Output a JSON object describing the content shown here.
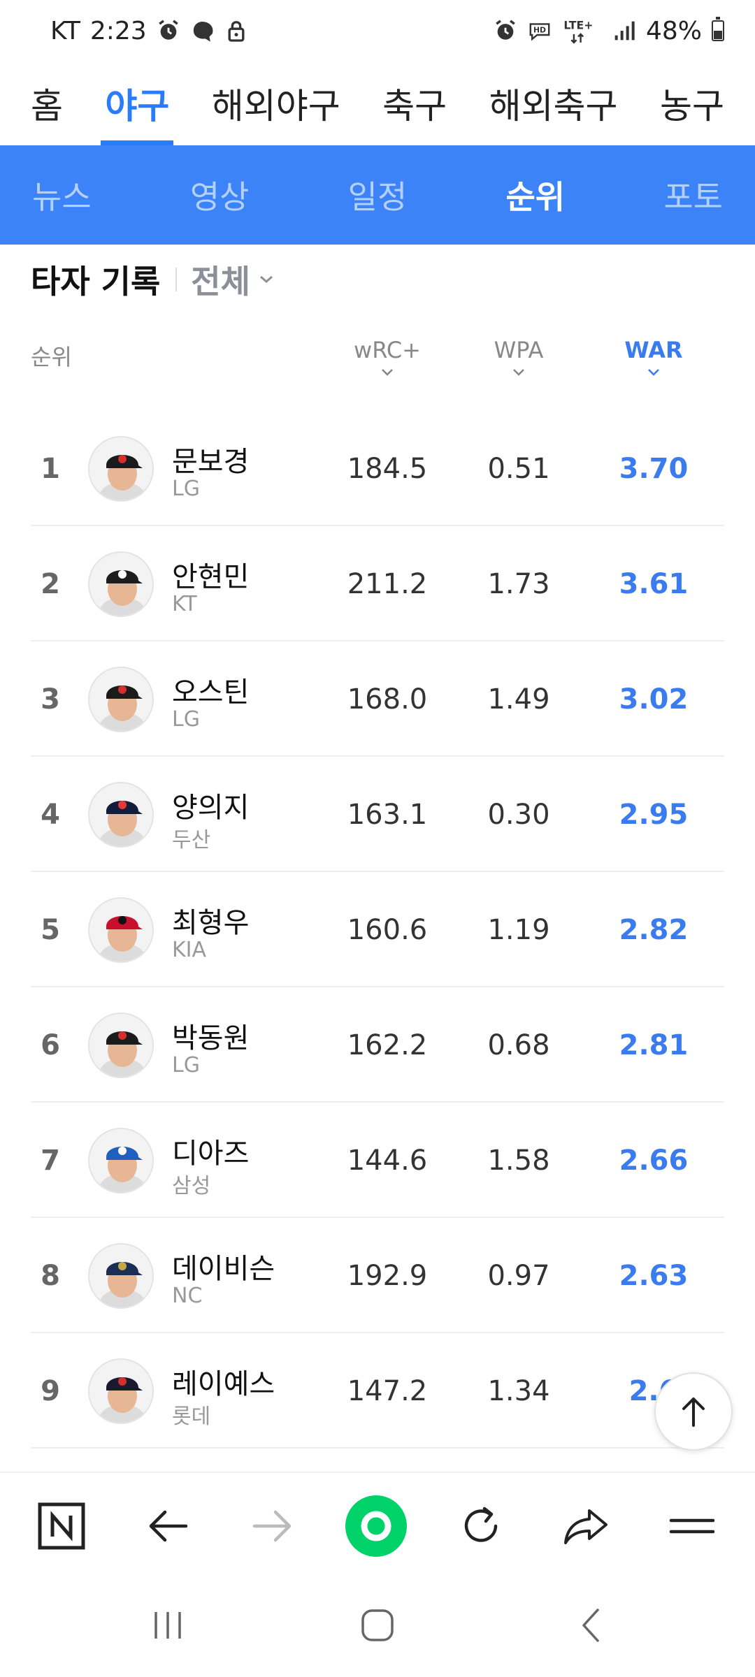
{
  "status_bar": {
    "carrier": "KT",
    "time": "2:23",
    "network": "LTE+",
    "battery": "48%",
    "battery_level": 0.48,
    "left_icons": [
      "alarm-icon",
      "messenger-icon",
      "lock-icon"
    ],
    "right_icons": [
      "alarm-icon",
      "hd-icon",
      "lte-icon",
      "signal-icon",
      "battery-icon"
    ]
  },
  "top_nav": {
    "tabs": [
      {
        "label": "홈"
      },
      {
        "label": "야구",
        "active": true
      },
      {
        "label": "해외야구"
      },
      {
        "label": "축구"
      },
      {
        "label": "해외축구"
      },
      {
        "label": "농구"
      }
    ]
  },
  "sub_nav": {
    "tabs": [
      {
        "label": "뉴스"
      },
      {
        "label": "영상"
      },
      {
        "label": "일정"
      },
      {
        "label": "순위",
        "active": true
      },
      {
        "label": "포토"
      }
    ]
  },
  "section": {
    "title": "타자 기록",
    "filter": "전체"
  },
  "table": {
    "rank_header": "순위",
    "columns": [
      {
        "label": "wRC+"
      },
      {
        "label": "WPA"
      },
      {
        "label": "WAR",
        "active": true
      }
    ],
    "rows": [
      {
        "rank": "1",
        "name": "문보경",
        "team": "LG",
        "wrc": "184.5",
        "wpa": "0.51",
        "war": "3.70",
        "cap": "#1b1b1b",
        "logo": "#d32f2f"
      },
      {
        "rank": "2",
        "name": "안현민",
        "team": "KT",
        "wrc": "211.2",
        "wpa": "1.73",
        "war": "3.61",
        "cap": "#1d1d1d",
        "logo": "#ffffff"
      },
      {
        "rank": "3",
        "name": "오스틴",
        "team": "LG",
        "wrc": "168.0",
        "wpa": "1.49",
        "war": "3.02",
        "cap": "#1b1b1b",
        "logo": "#d32f2f"
      },
      {
        "rank": "4",
        "name": "양의지",
        "team": "두산",
        "wrc": "163.1",
        "wpa": "0.30",
        "war": "2.95",
        "cap": "#131c3a",
        "logo": "#e53935"
      },
      {
        "rank": "5",
        "name": "최형우",
        "team": "KIA",
        "wrc": "160.6",
        "wpa": "1.19",
        "war": "2.82",
        "cap": "#c8102e",
        "logo": "#111111"
      },
      {
        "rank": "6",
        "name": "박동원",
        "team": "LG",
        "wrc": "162.2",
        "wpa": "0.68",
        "war": "2.81",
        "cap": "#1b1b1b",
        "logo": "#d32f2f"
      },
      {
        "rank": "7",
        "name": "디아즈",
        "team": "삼성",
        "wrc": "144.6",
        "wpa": "1.58",
        "war": "2.66",
        "cap": "#1f5fbf",
        "logo": "#ffffff"
      },
      {
        "rank": "8",
        "name": "데이비슨",
        "team": "NC",
        "wrc": "192.9",
        "wpa": "0.97",
        "war": "2.63",
        "cap": "#1b2f55",
        "logo": "#c9a54a"
      },
      {
        "rank": "9",
        "name": "레이예스",
        "team": "롯데",
        "wrc": "147.2",
        "wpa": "1.34",
        "war": "2.6",
        "cap": "#1a1a2e",
        "logo": "#d32f2f"
      }
    ]
  },
  "toolbar": {
    "icons": [
      "naver-n-icon",
      "back-arrow-icon",
      "forward-arrow-icon",
      "green-dot-icon",
      "refresh-icon",
      "share-icon",
      "menu-icon"
    ]
  },
  "system_nav": {
    "icons": [
      "recents-icon",
      "home-icon",
      "back-icon"
    ]
  },
  "colors": {
    "accent": "#2b7bff",
    "sub_nav_bg": "#3c83f7",
    "war_blue": "#3a7cf0",
    "green_dot": "#00d26a"
  }
}
